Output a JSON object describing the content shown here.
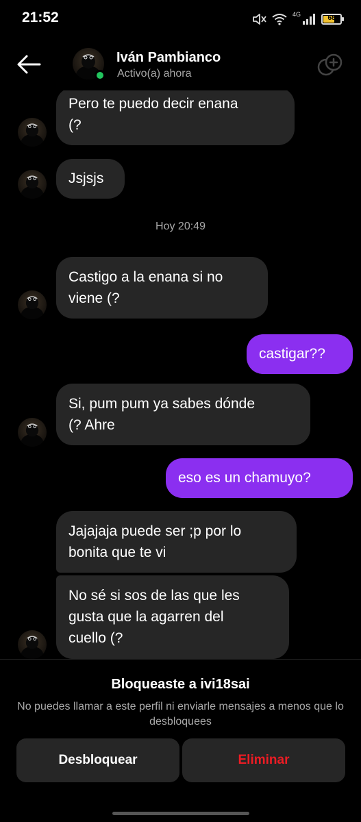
{
  "status_bar": {
    "time": "21:52",
    "network": "4G",
    "battery": "68",
    "battery_level": 0.68,
    "icons": [
      "mute-icon",
      "wifi-icon",
      "signal-icon",
      "battery-icon"
    ]
  },
  "header": {
    "back_icon": "arrow-left-icon",
    "contact_name": "Iván Pambianco",
    "contact_status": "Activo(a) ahora",
    "group_icon": "add-people-icon"
  },
  "messages": [
    {
      "side": "in",
      "lines": [
        "Pero te puedo decir enana",
        "(?"
      ]
    },
    {
      "side": "in",
      "lines": [
        "Jsjsjs"
      ]
    },
    {
      "type": "timestamp",
      "text": "Hoy 20:49"
    },
    {
      "side": "in",
      "lines": [
        "Castigo a la enana si no",
        "viene (?"
      ]
    },
    {
      "side": "out",
      "lines": [
        "castigar??"
      ]
    },
    {
      "side": "in",
      "lines": [
        "Si, pum pum ya sabes dónde",
        "(? Ahre"
      ]
    },
    {
      "side": "out",
      "lines": [
        "eso es un chamuyo?"
      ]
    },
    {
      "side": "in",
      "lines": [
        "Jajajaja puede ser ;p por lo",
        "bonita que te vi"
      ]
    },
    {
      "side": "in",
      "lines": [
        "No sé si sos de las que les",
        "gusta que la agarren del",
        "cuello (?"
      ]
    }
  ],
  "blocked": {
    "title": "Bloqueaste a ivi18sai",
    "description": "No puedes llamar a este perfil ni enviarle mensajes a menos que lo desbloquees",
    "unblock_label": "Desbloquear",
    "delete_label": "Eliminar"
  },
  "colors": {
    "outgoing_bubble": "#8b2ff0",
    "incoming_bubble": "#262626",
    "delete_text": "#ed1c24",
    "online": "#22c55e"
  }
}
